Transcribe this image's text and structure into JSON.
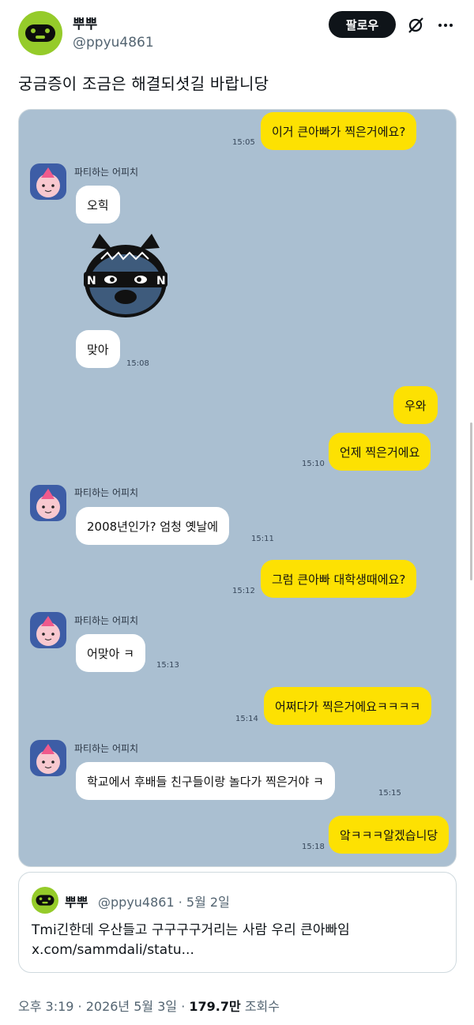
{
  "author": {
    "display_name": "뿌뿌",
    "handle": "@ppyu4861"
  },
  "follow_label": "팔로우",
  "tweet_text": "궁금증이 조금은 해결되셧길 바랍니당",
  "chat": {
    "peer_name": "파티하는 어피치",
    "messages": [
      {
        "from": "me",
        "text": "이거 큰아빠가 찍은거에요?",
        "time": "15:05"
      },
      {
        "from": "other",
        "text": "오힉",
        "time": ""
      },
      {
        "from": "other",
        "text": "맞아",
        "time": "15:08"
      },
      {
        "from": "me",
        "text": "우와",
        "time": ""
      },
      {
        "from": "me",
        "text": "언제 찍은거에요",
        "time": "15:10"
      },
      {
        "from": "other",
        "text": "2008년인가? 엄청 옛날에",
        "time": "15:11"
      },
      {
        "from": "me",
        "text": "그럼 큰아빠 대학생때에요?",
        "time": "15:12"
      },
      {
        "from": "other",
        "text": "어맞아 ㅋ",
        "time": "15:13"
      },
      {
        "from": "me",
        "text": "어쩌다가 찍은거에요ㅋㅋㅋㅋ",
        "time": "15:14"
      },
      {
        "from": "other",
        "text": "학교에서 후배들 친구들이랑 놀다가 찍은거야 ㅋ",
        "time": "15:15"
      },
      {
        "from": "me",
        "text": "앜ㅋㅋㅋ알겠습니당",
        "time": "15:18"
      }
    ]
  },
  "quote": {
    "display_name": "뿌뿌",
    "meta": "@ppyu4861 · 5월 2일",
    "text": "Tmi긴한데 우산들고 구구구구거리는 사람 우리 큰아빠임",
    "link": "x.com/sammdali/statu..."
  },
  "footer": {
    "time": "오후 3:19 · 2026년 5월 3일 · ",
    "views": "179.7만",
    "views_label": " 조회수"
  },
  "colors": {
    "chat_bg": "#aabfd1",
    "my_bubble": "#fde102",
    "avatar_green": "#95cb2a"
  }
}
